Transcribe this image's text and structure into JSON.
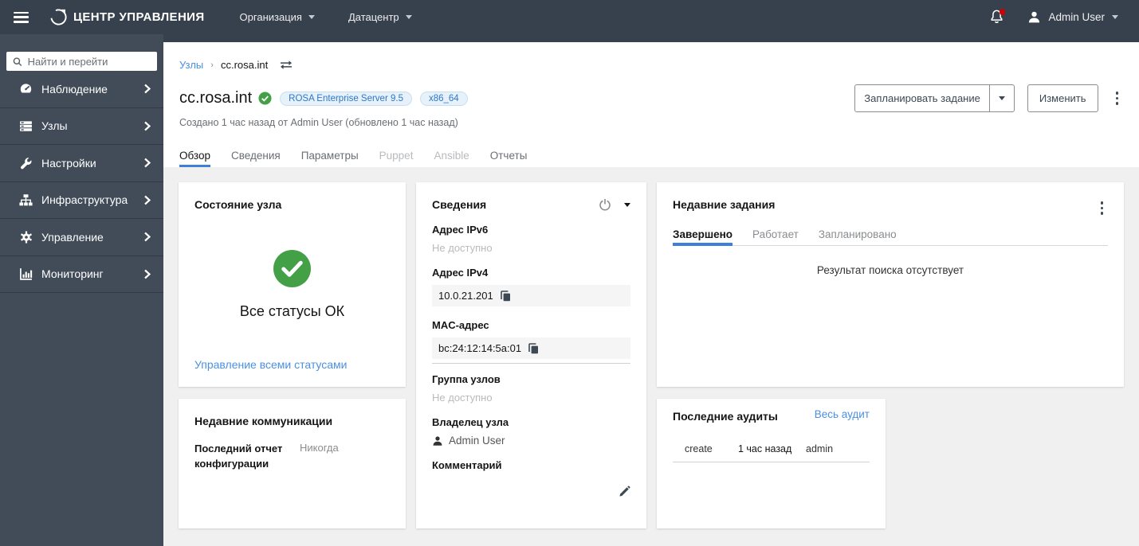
{
  "topbar": {
    "brand": "ЦЕНТР УПРАВЛЕНИЯ",
    "menus": [
      {
        "label": "Организация"
      },
      {
        "label": "Датацентр"
      }
    ],
    "user": "Admin User"
  },
  "sidebar": {
    "search_placeholder": "Найти и перейти",
    "items": [
      {
        "label": "Наблюдение",
        "icon": "tachometer-icon"
      },
      {
        "label": "Узлы",
        "icon": "server-icon"
      },
      {
        "label": "Настройки",
        "icon": "wrench-icon"
      },
      {
        "label": "Инфраструктура",
        "icon": "sitemap-icon"
      },
      {
        "label": "Управление",
        "icon": "gear-icon"
      },
      {
        "label": "Мониторинг",
        "icon": "chart-icon"
      }
    ]
  },
  "breadcrumb": {
    "root": "Узлы",
    "current": "cc.rosa.int"
  },
  "header": {
    "title": "cc.rosa.int",
    "badges": [
      "ROSA Enterprise Server 9.5",
      "x86_64"
    ],
    "subtitle": "Создано 1 час назад от Admin User (обновлено 1 час назад)",
    "actions": {
      "schedule_job": "Запланировать задание",
      "edit": "Изменить"
    }
  },
  "tabs": [
    {
      "label": "Обзор",
      "state": "active"
    },
    {
      "label": "Сведения",
      "state": "normal"
    },
    {
      "label": "Параметры",
      "state": "normal"
    },
    {
      "label": "Puppet",
      "state": "disabled"
    },
    {
      "label": "Ansible",
      "state": "disabled"
    },
    {
      "label": "Отчеты",
      "state": "normal"
    }
  ],
  "cards": {
    "status": {
      "title": "Состояние узла",
      "status_text": "Все статусы ОК",
      "link": "Управление всеми статусами"
    },
    "communications": {
      "title": "Недавние коммуникации",
      "label": "Последний отчет конфигурации",
      "value": "Никогда"
    },
    "details": {
      "title": "Сведения",
      "fields": [
        {
          "label": "Адрес IPv6",
          "value": "Не доступно"
        },
        {
          "label": "Адрес IPv4",
          "value": "10.0.21.201"
        },
        {
          "label": "MAC-адрес",
          "value": "bc:24:12:14:5a:01"
        },
        {
          "label": "Группа узлов",
          "value": "Не доступно"
        },
        {
          "label": "Владелец узла",
          "value": "Admin User"
        },
        {
          "label": "Комментарий",
          "value": ""
        }
      ]
    },
    "jobs": {
      "title": "Недавние задания",
      "tabs": [
        {
          "label": "Завершено"
        },
        {
          "label": "Работает"
        },
        {
          "label": "Запланировано"
        }
      ],
      "empty_text": "Результат поиска отсутствует"
    },
    "audits": {
      "title": "Последние аудиты",
      "link": "Весь аудит",
      "rows": [
        {
          "action": "create",
          "time": "1 час назад",
          "user": "admin"
        }
      ]
    }
  },
  "colors": {
    "navbar_bg": "#37414d",
    "sidebar_bg": "#414c58",
    "accent_blue": "#4a90e2",
    "tab_underline": "#3d7fd9",
    "success_green": "#43a047",
    "badge_bg": "#e7f1fa",
    "badge_text": "#2b77c9",
    "notification_red": "#cc0000"
  }
}
